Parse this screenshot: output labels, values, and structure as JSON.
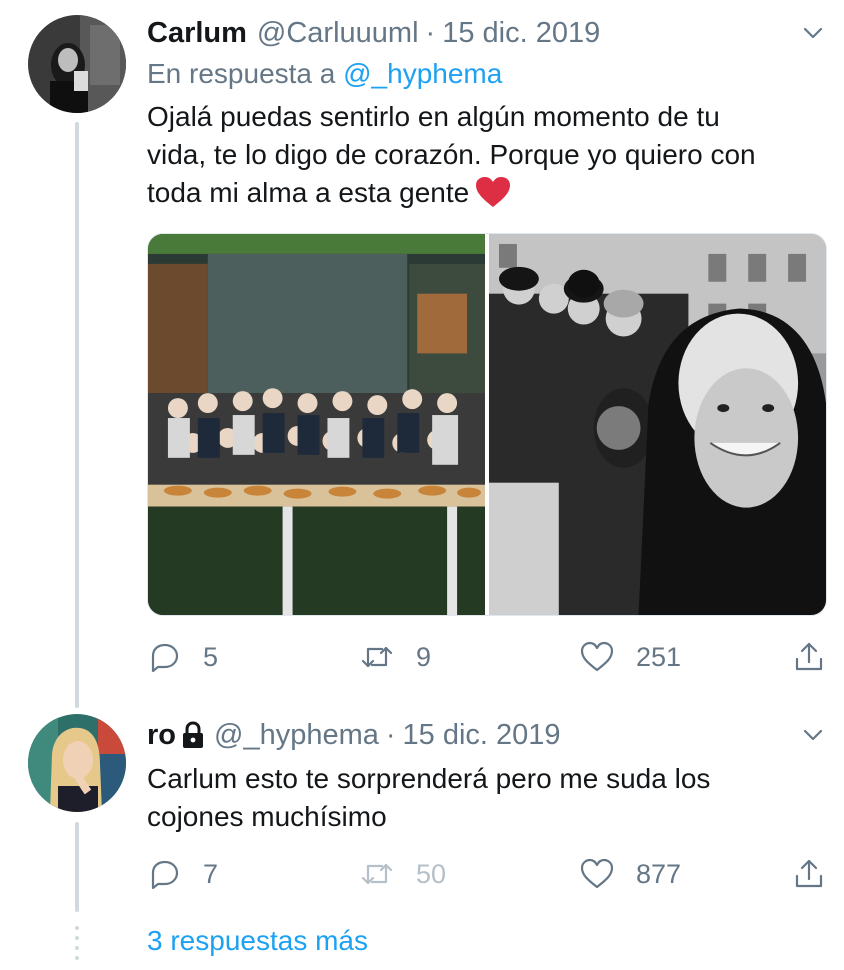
{
  "tweets": [
    {
      "name": "Carlum",
      "handle": "@Carluuuml",
      "separator": "·",
      "date": "15 dic. 2019",
      "reply_prefix": "En respuesta a",
      "reply_mention": "@_hyphema",
      "text_lines": [
        "Ojalá puedas sentirlo en algún momento de tu",
        "vida, te lo digo de corazón. Porque yo quiero con",
        "toda mi alma a esta gente"
      ],
      "emoji": "red-heart",
      "media": [
        "group-photo-office",
        "group-selfie-bw"
      ],
      "actions": {
        "reply": "5",
        "retweet": "9",
        "like": "251"
      }
    },
    {
      "name": "ro",
      "protected_icon": "lock-icon",
      "handle": "@_hyphema",
      "separator": "·",
      "date": "15 dic. 2019",
      "text_lines": [
        "Carlum esto te sorprenderá pero me suda los",
        "cojones muchísimo"
      ],
      "actions": {
        "reply": "7",
        "retweet": "50",
        "like": "877"
      },
      "retweet_disabled": true
    }
  ],
  "more_replies": "3 respuestas más",
  "colors": {
    "text": "#14171a",
    "secondary": "#657786",
    "link": "#1da1f2",
    "thread_line": "#cfd9de",
    "heart": "#e0245e"
  }
}
